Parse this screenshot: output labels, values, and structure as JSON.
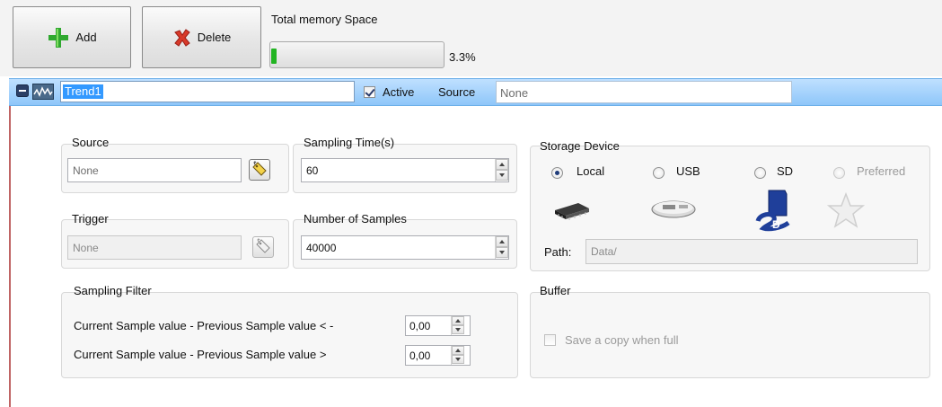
{
  "toolbar": {
    "add_label": "Add",
    "delete_label": "Delete",
    "memory_title": "Total memory Space",
    "memory_percent_text": "3.3%",
    "memory_fraction": 0.033
  },
  "itembar": {
    "name_value": "Trend1",
    "active_label": "Active",
    "active_checked": true,
    "source_label": "Source",
    "source_value": "None"
  },
  "source_group": {
    "title": "Source",
    "value": "None"
  },
  "sampling_time_group": {
    "title": "Sampling Time(s)",
    "value": "60"
  },
  "trigger_group": {
    "title": "Trigger",
    "value": "None"
  },
  "samples_group": {
    "title": "Number of Samples",
    "value": "40000"
  },
  "storage_group": {
    "title": "Storage Device",
    "options": [
      {
        "label": "Local",
        "selected": true,
        "enabled": true,
        "icon": "chip-icon"
      },
      {
        "label": "USB",
        "selected": false,
        "enabled": true,
        "icon": "usb-drive-icon"
      },
      {
        "label": "SD",
        "selected": false,
        "enabled": true,
        "icon": "sd-card-icon"
      },
      {
        "label": "Preferred",
        "selected": false,
        "enabled": false,
        "icon": "star-icon"
      }
    ],
    "path_label": "Path:",
    "path_value": "Data/"
  },
  "filter_group": {
    "title": "Sampling Filter",
    "rows": [
      {
        "label": "Current Sample value - Previous Sample value < -",
        "value": "0,00"
      },
      {
        "label": "Current Sample value - Previous Sample value >",
        "value": "0,00"
      }
    ]
  },
  "buffer_group": {
    "title": "Buffer",
    "copy_label": "Save a copy when full",
    "copy_checked": false
  },
  "colors": {
    "selection_bar": "#8ec6f9",
    "progress_fill": "#22b422",
    "text_selection": "#3399ff"
  }
}
